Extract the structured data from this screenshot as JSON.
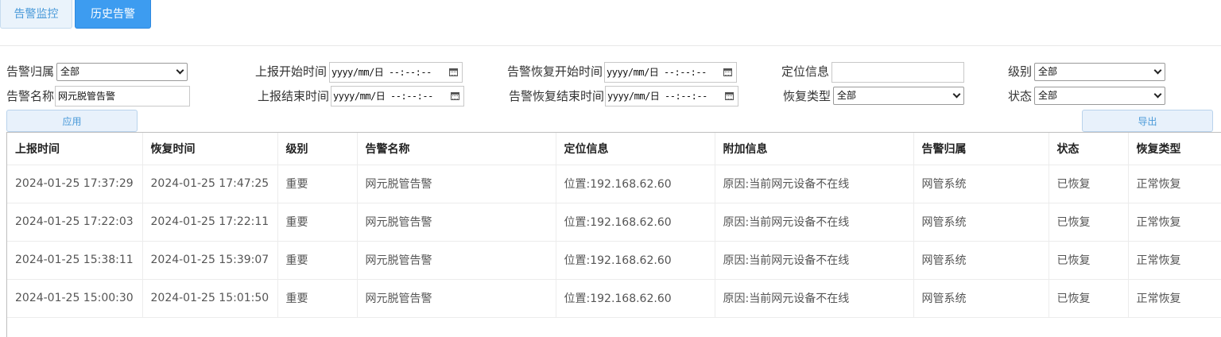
{
  "tabs": {
    "monitor": "告警监控",
    "history": "历史告警"
  },
  "filters": {
    "alarm_owner_label": "告警归属",
    "alarm_owner_value": "全部",
    "alarm_name_label": "告警名称",
    "alarm_name_value": "网元脱管告警",
    "report_start_label": "上报开始时间",
    "report_start_value": "yyyy/mm/日 --:--:--",
    "report_end_label": "上报结束时间",
    "report_end_value": "yyyy/mm/日 --:--:--",
    "recover_start_label": "告警恢复开始时间",
    "recover_start_value": "yyyy/mm/日 --:--:--",
    "recover_end_label": "告警恢复结束时间",
    "recover_end_value": "yyyy/mm/日 --:--:--",
    "location_label": "定位信息",
    "location_value": "",
    "recover_type_label": "恢复类型",
    "recover_type_value": "全部",
    "level_label": "级别",
    "level_value": "全部",
    "status_label": "状态",
    "status_value": "全部"
  },
  "buttons": {
    "apply": "应用",
    "export": "导出"
  },
  "table": {
    "headers": [
      "上报时间",
      "恢复时间",
      "级别",
      "告警名称",
      "定位信息",
      "附加信息",
      "告警归属",
      "状态",
      "恢复类型"
    ],
    "rows": [
      [
        "2024-01-25 17:37:29",
        "2024-01-25 17:47:25",
        "重要",
        "网元脱管告警",
        "位置:192.168.62.60",
        "原因:当前网元设备不在线",
        "网管系统",
        "已恢复",
        "正常恢复"
      ],
      [
        "2024-01-25 17:22:03",
        "2024-01-25 17:22:11",
        "重要",
        "网元脱管告警",
        "位置:192.168.62.60",
        "原因:当前网元设备不在线",
        "网管系统",
        "已恢复",
        "正常恢复"
      ],
      [
        "2024-01-25 15:38:11",
        "2024-01-25 15:39:07",
        "重要",
        "网元脱管告警",
        "位置:192.168.62.60",
        "原因:当前网元设备不在线",
        "网管系统",
        "已恢复",
        "正常恢复"
      ],
      [
        "2024-01-25 15:00:30",
        "2024-01-25 15:01:50",
        "重要",
        "网元脱管告警",
        "位置:192.168.62.60",
        "原因:当前网元设备不在线",
        "网管系统",
        "已恢复",
        "正常恢复"
      ]
    ]
  }
}
